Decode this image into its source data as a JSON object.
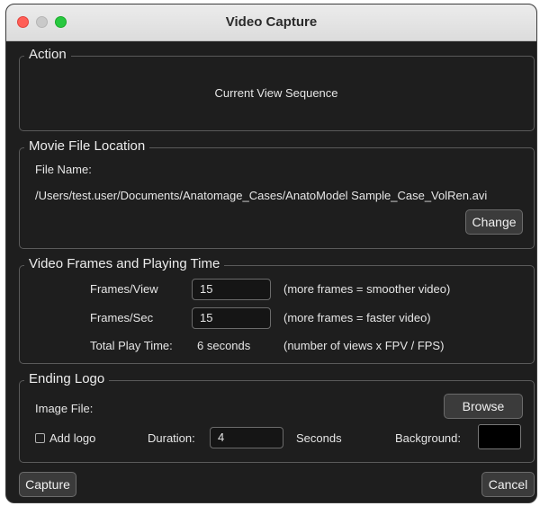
{
  "window": {
    "title": "Video Capture"
  },
  "action": {
    "title": "Action",
    "value": "Current View Sequence"
  },
  "movie": {
    "title": "Movie File Location",
    "file_label": "File Name:",
    "path": "/Users/test.user/Documents/Anatomage_Cases/AnatoModel Sample_Case_VolRen.avi",
    "change_label": "Change"
  },
  "frames": {
    "title": "Video Frames and Playing Time",
    "fpv_label": "Frames/View",
    "fpv_value": "15",
    "fpv_hint": "(more frames = smoother video)",
    "fps_label": "Frames/Sec",
    "fps_value": "15",
    "fps_hint": "(more frames = faster video)",
    "total_label": "Total Play Time:",
    "total_value": "6 seconds",
    "total_hint": "(number of views x FPV / FPS)"
  },
  "logo": {
    "title": "Ending Logo",
    "image_label": "Image File:",
    "browse_label": "Browse",
    "add_logo_label": "Add logo",
    "add_logo_checked": false,
    "duration_label": "Duration:",
    "duration_value": "4",
    "seconds_label": "Seconds",
    "background_label": "Background:",
    "background_color": "#000000"
  },
  "footer": {
    "capture_label": "Capture",
    "cancel_label": "Cancel"
  }
}
